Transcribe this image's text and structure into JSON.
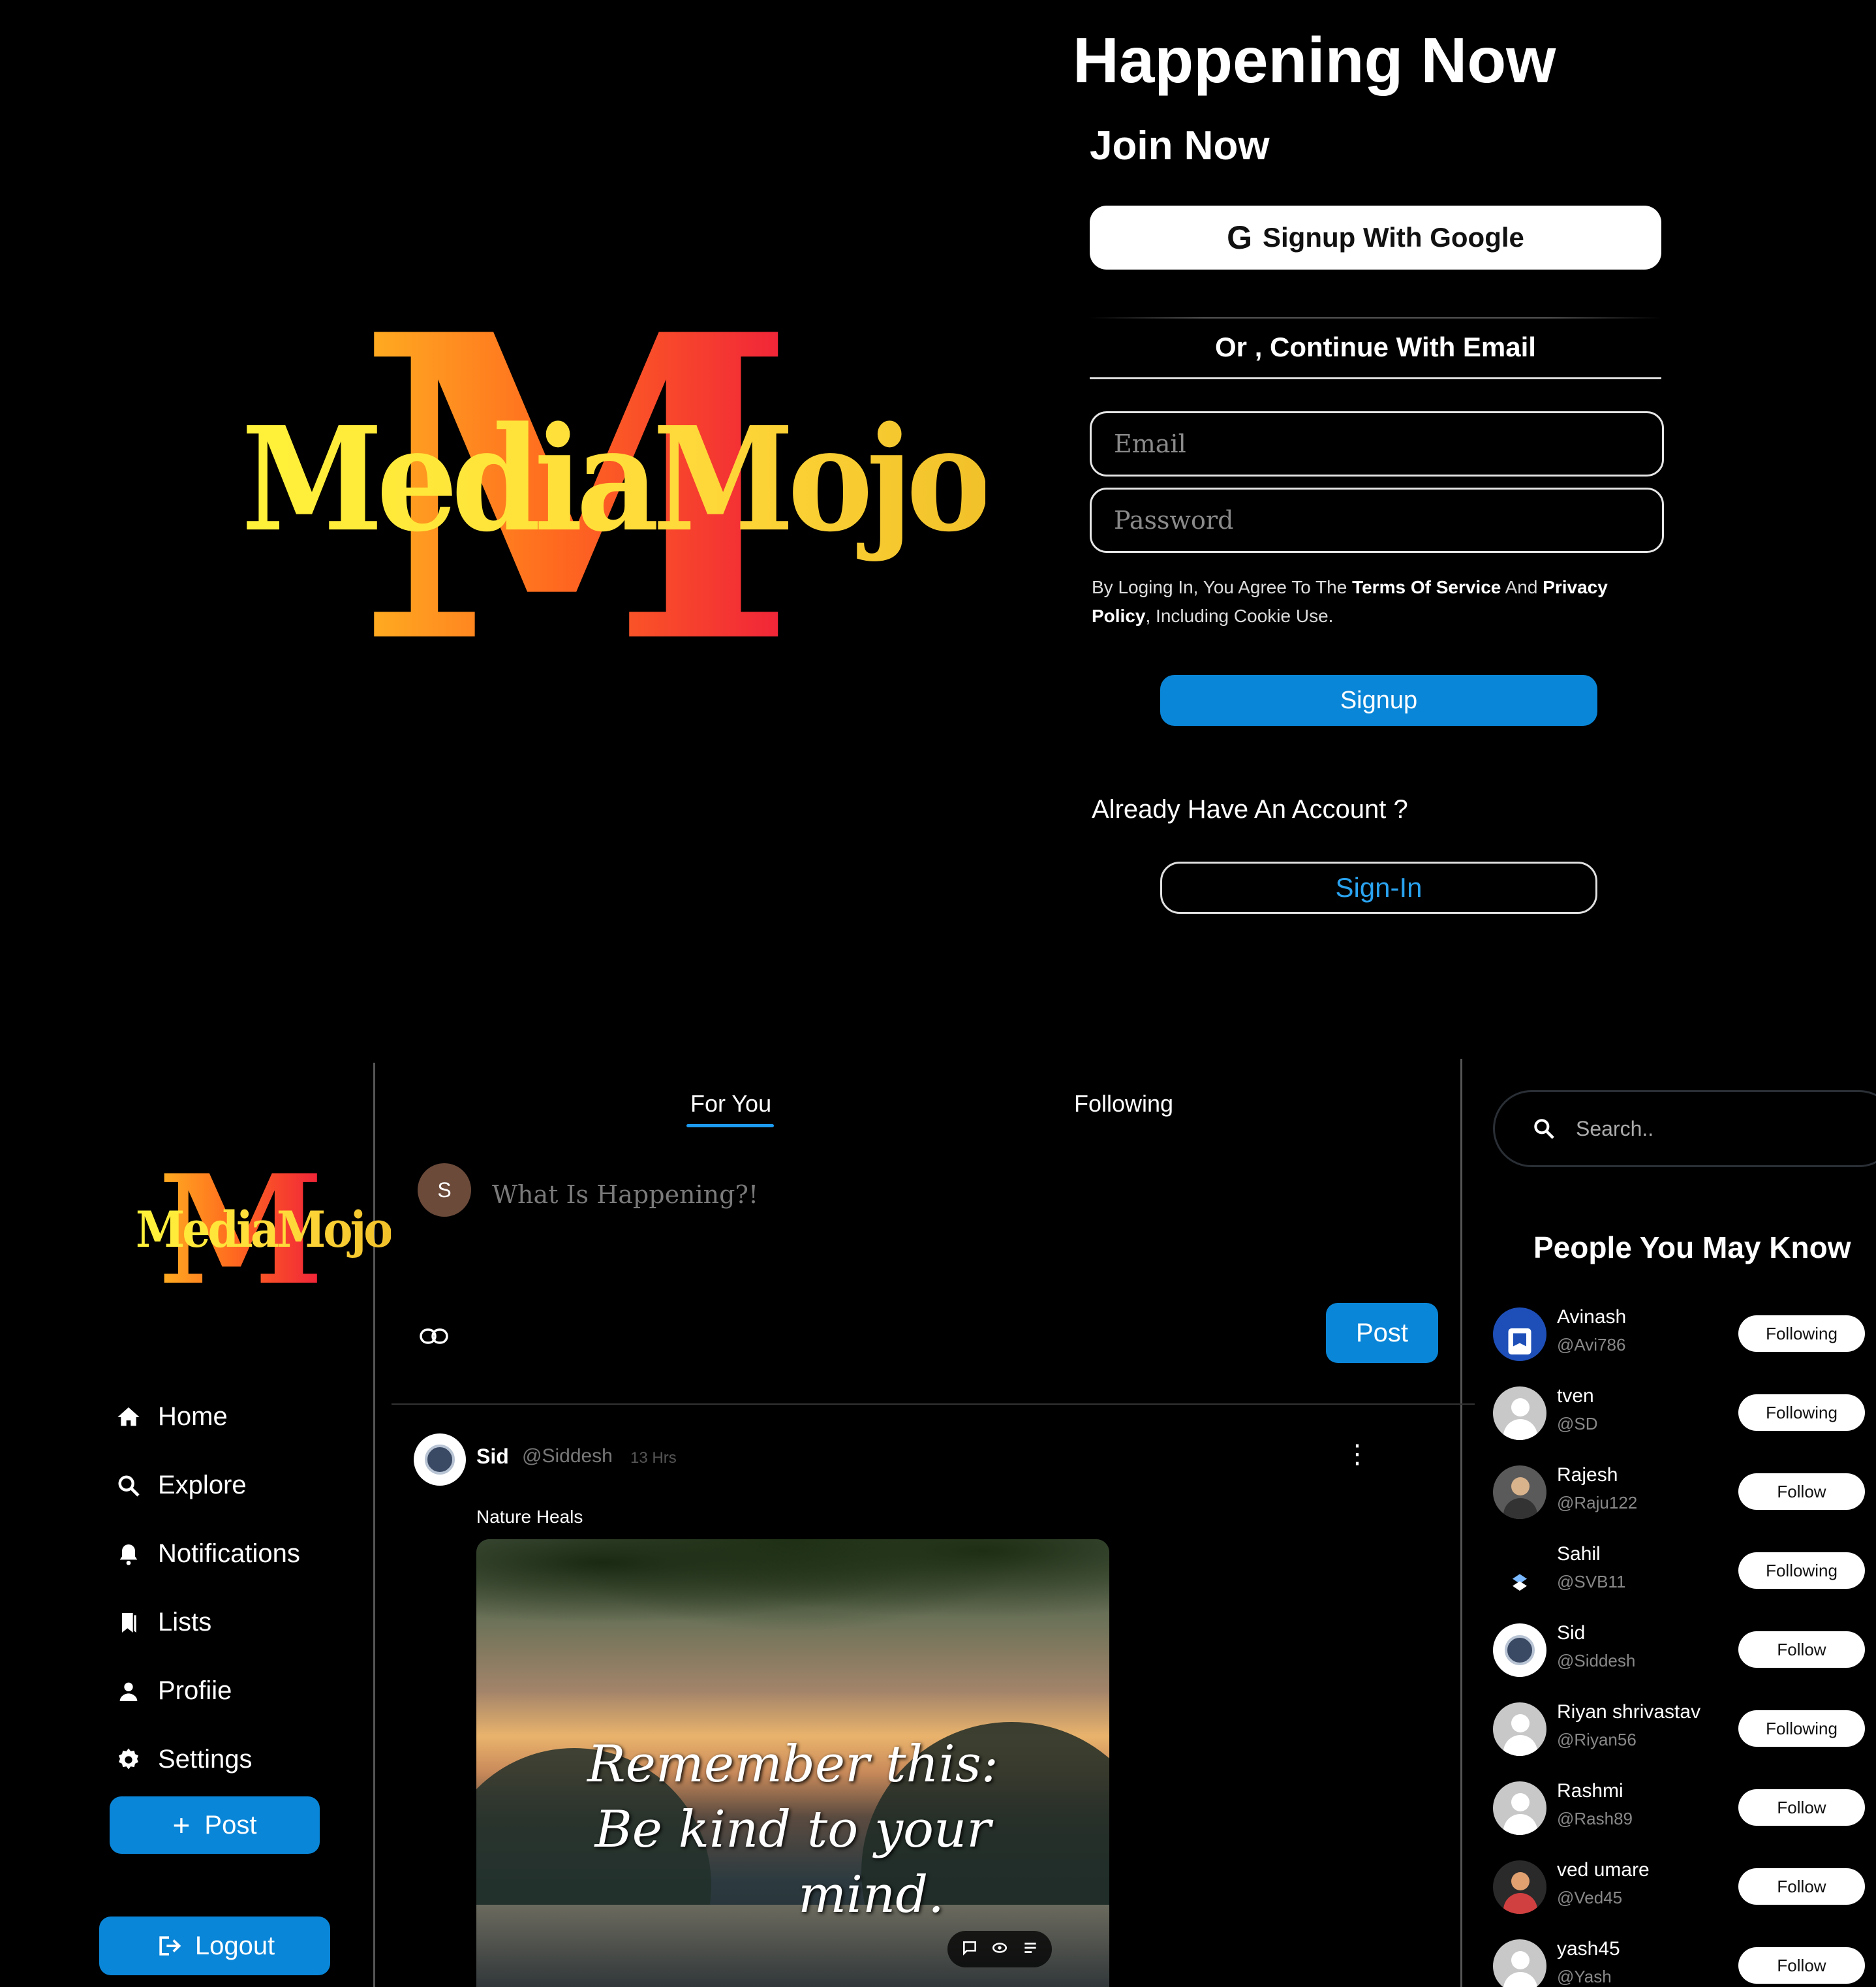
{
  "brand": {
    "name": "MediaMojo",
    "logo_letter": "M"
  },
  "signup": {
    "headline": "Happening Now",
    "join_title": "Join Now",
    "google_icon": "G",
    "google_button": "Signup With Google",
    "divider_text": "Or , Continue With Email",
    "email_placeholder": "Email",
    "password_placeholder": "Password",
    "agree_prefix": "By Loging In, You Agree To The ",
    "terms": "Terms Of Service",
    "agree_and": " And ",
    "privacy": "Privacy Policy",
    "agree_suffix": ", Including Cookie Use.",
    "signup_button": "Signup",
    "already_text": "Already Have An Account ?",
    "signin_button": "Sign-In"
  },
  "sidebar": {
    "items": [
      {
        "label": "Home",
        "icon": "home-icon"
      },
      {
        "label": "Explore",
        "icon": "search-icon"
      },
      {
        "label": "Notifications",
        "icon": "bell-icon"
      },
      {
        "label": "Lists",
        "icon": "bookmark-icon"
      },
      {
        "label": "Profiie",
        "icon": "person-icon"
      },
      {
        "label": "Settings",
        "icon": "gear-icon"
      }
    ],
    "post_button": "Post",
    "logout_button": "Logout"
  },
  "feed": {
    "tabs": [
      "For You",
      "Following"
    ],
    "active_tab": "For You",
    "compose_avatar": "S",
    "compose_placeholder": "What Is Happening?!",
    "post_button": "Post",
    "post": {
      "name": "Sid",
      "handle": "@Siddesh",
      "time": "13 Hrs",
      "text": "Nature Heals",
      "image_quote": [
        "Remember this:",
        "Be kind to your",
        "mind."
      ]
    }
  },
  "right": {
    "search_placeholder": "Search..",
    "pymk_title": "People You May Know",
    "people": [
      {
        "name": "Avinash",
        "handle": "@Avi786",
        "button": "Following"
      },
      {
        "name": "tven",
        "handle": "@SD",
        "button": "Following"
      },
      {
        "name": "Rajesh",
        "handle": "@Raju122",
        "button": "Follow"
      },
      {
        "name": "Sahil",
        "handle": "@SVB11",
        "button": "Following"
      },
      {
        "name": "Sid",
        "handle": "@Siddesh",
        "button": "Follow"
      },
      {
        "name": "Riyan shrivastav",
        "handle": "@Riyan56",
        "button": "Following"
      },
      {
        "name": "Rashmi",
        "handle": "@Rash89",
        "button": "Follow"
      },
      {
        "name": "ved umare",
        "handle": "@Ved45",
        "button": "Follow"
      },
      {
        "name": "yash45",
        "handle": "@Yash",
        "button": "Follow"
      }
    ]
  },
  "colors": {
    "accent": "#0a86d8",
    "link": "#2aa3f0",
    "background": "#000000"
  }
}
